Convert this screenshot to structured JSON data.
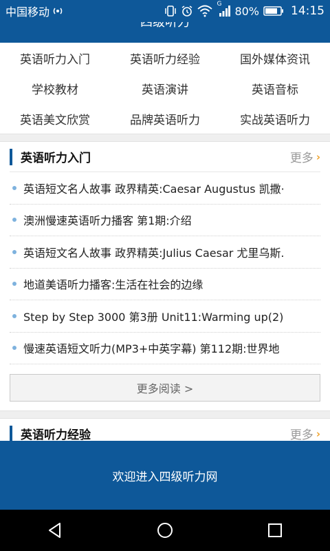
{
  "status_bar": {
    "carrier": "中国移动",
    "battery": "80%",
    "time": "14:15",
    "network_label": "G"
  },
  "header": {
    "title": "四级听力"
  },
  "categories": [
    "英语听力入门",
    "英语听力经验",
    "国外媒体资讯",
    "学校教材",
    "英语演讲",
    "英语音标",
    "英语美文欣赏",
    "品牌英语听力",
    "实战英语听力"
  ],
  "sections": [
    {
      "title": "英语听力入门",
      "more_label": "更多",
      "items": [
        "英语短文名人故事 政界精英:Caesar Augustus 凯撒·",
        "澳洲慢速英语听力播客 第1期:介绍",
        "英语短文名人故事 政界精英:Julius Caesar 尤里乌斯.",
        "地道美语听力播客:生活在社会的边缘",
        "Step by Step 3000 第3册 Unit11:Warming up(2)",
        "慢速英语短文听力(MP3+中英字幕) 第112期:世界地"
      ],
      "more_reading": "更多阅读 >"
    },
    {
      "title": "英语听力经验",
      "more_label": "更多"
    }
  ],
  "banner": {
    "text": "欢迎进入四级听力网"
  },
  "colors": {
    "primary": "#0e5899",
    "accent": "#f0a22a",
    "bullet": "#7eb2de"
  }
}
